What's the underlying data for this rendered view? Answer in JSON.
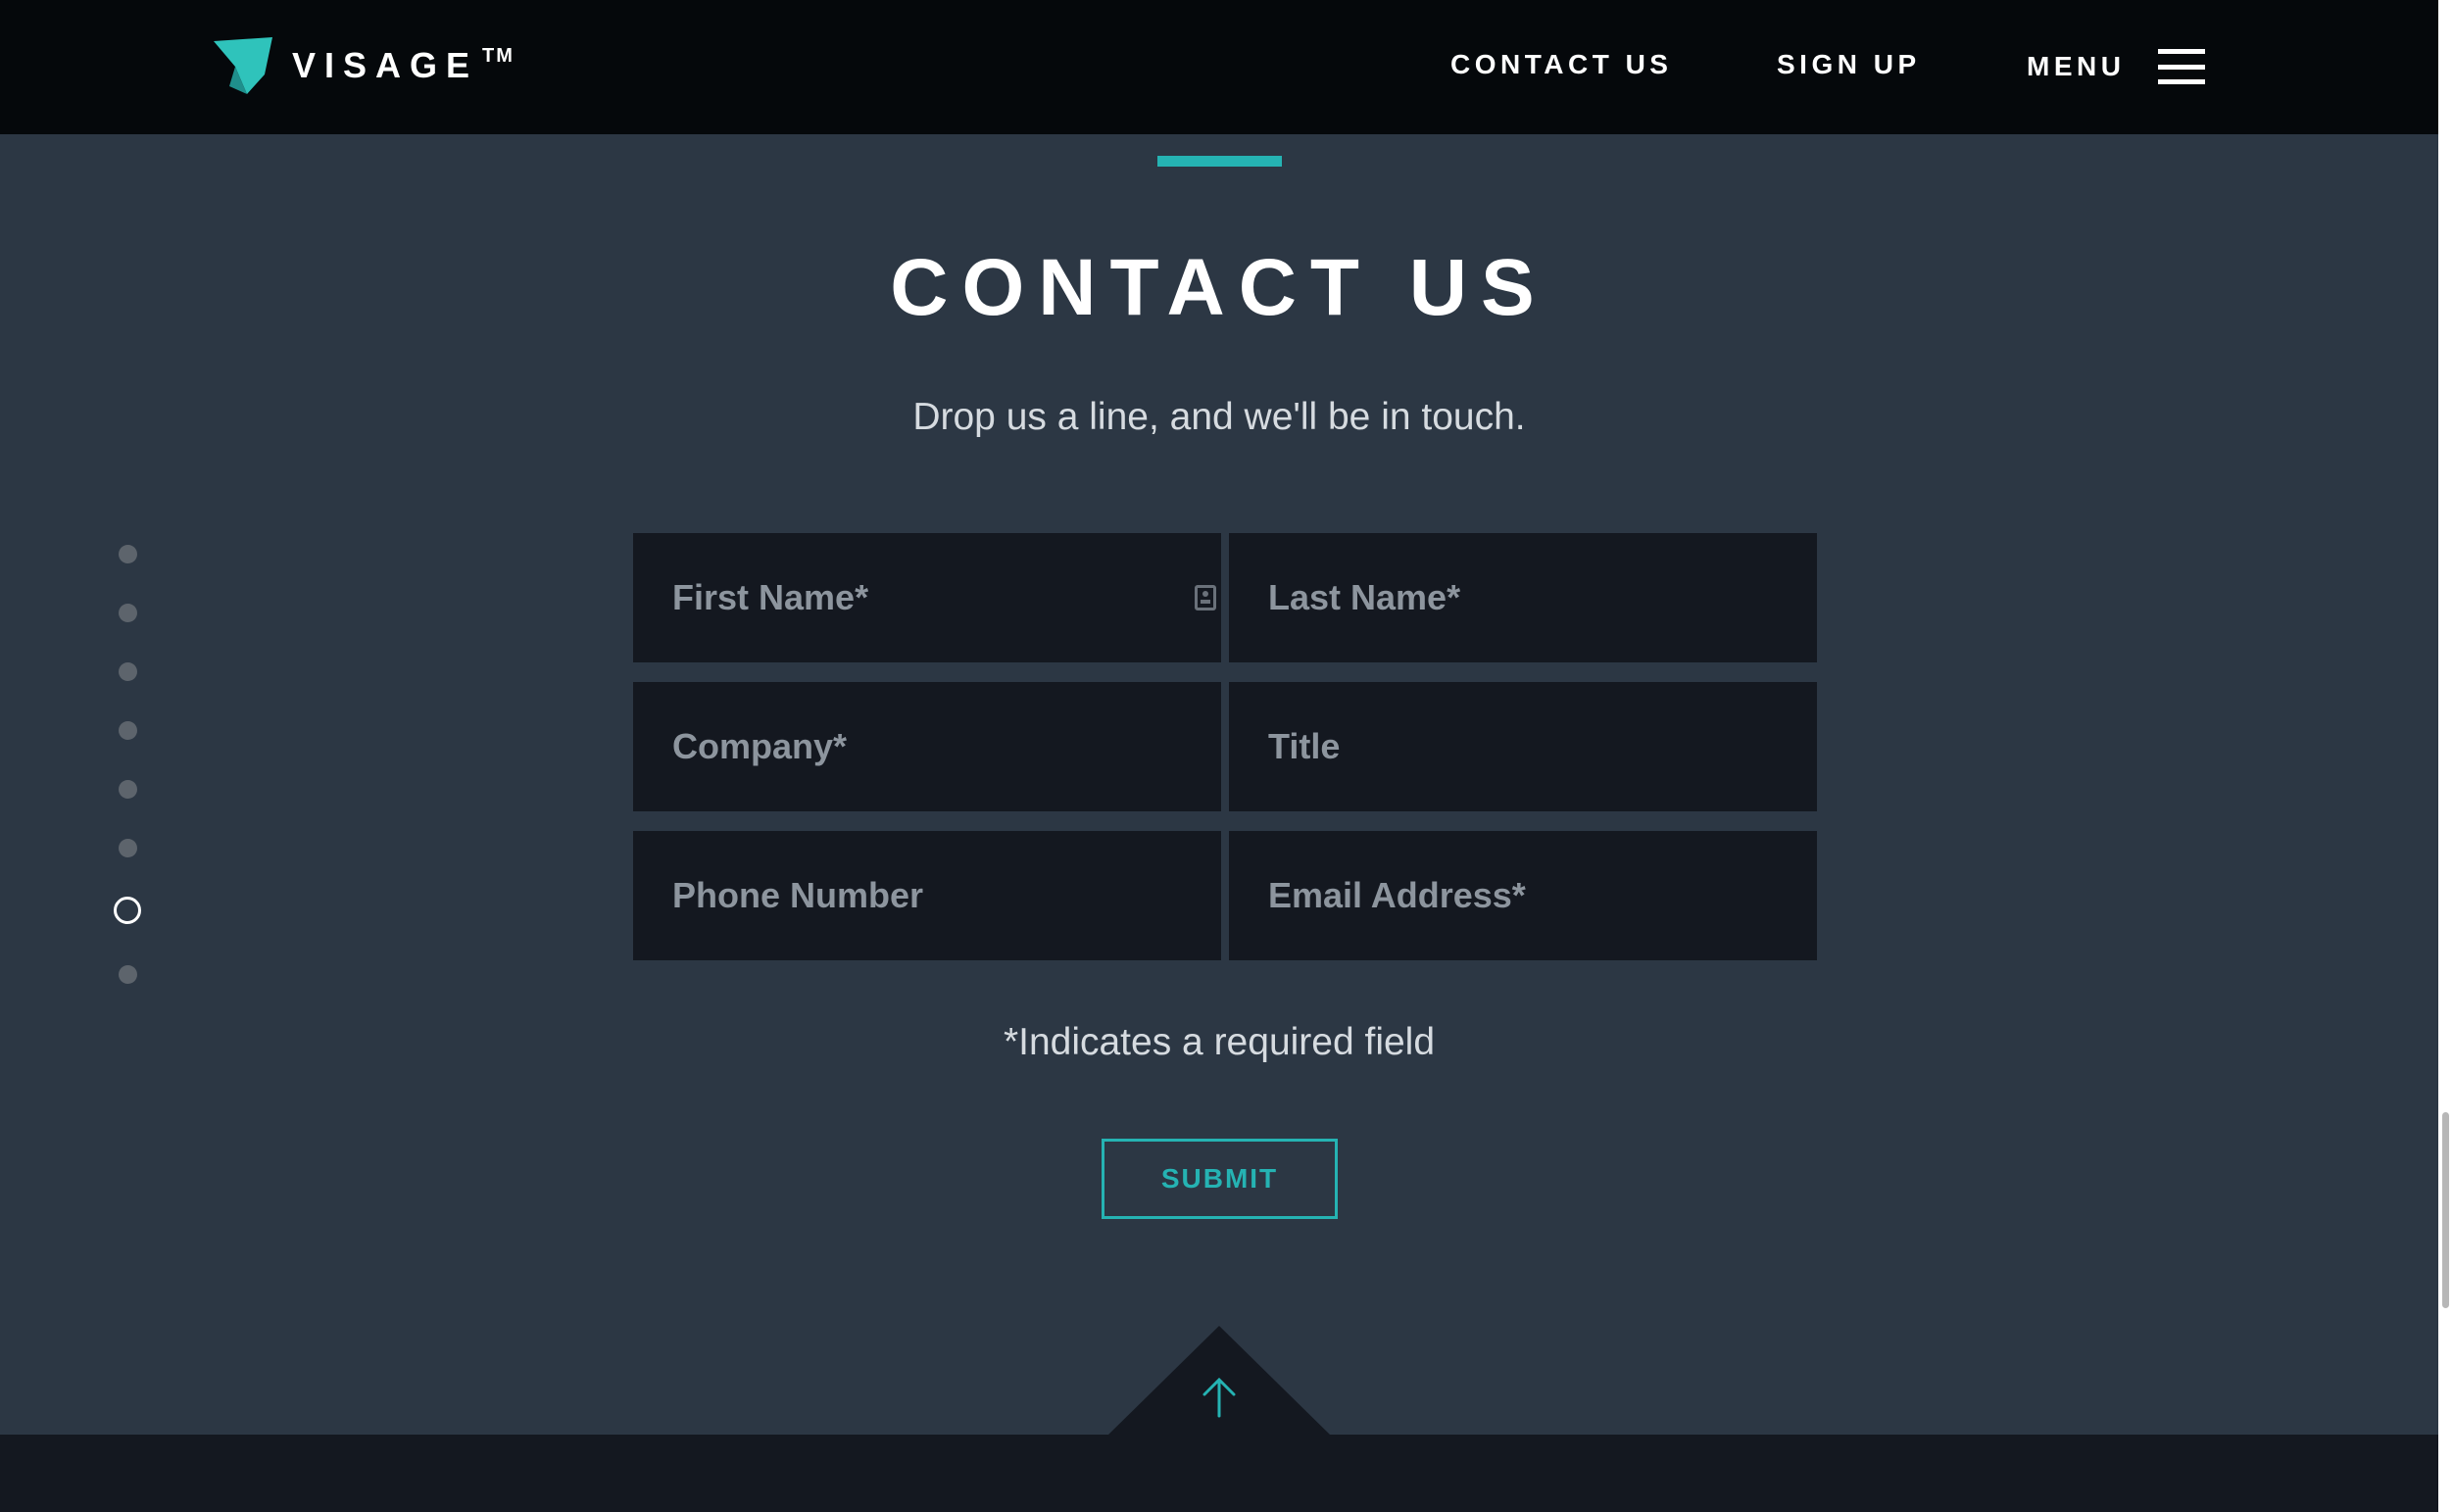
{
  "brand": {
    "name": "VISAGE",
    "trademark": "TM",
    "accent_color": "#25b3b3"
  },
  "nav": {
    "contact_label": "CONTACT US",
    "signup_label": "SIGN UP",
    "menu_label": "MENU"
  },
  "section": {
    "title": "CONTACT US",
    "subtitle": "Drop us a line, and we'll be in touch."
  },
  "side_nav": {
    "dot_count": 8,
    "active_index": 6
  },
  "form": {
    "fields": {
      "first_name": {
        "placeholder": "First Name*",
        "value": ""
      },
      "last_name": {
        "placeholder": "Last Name*",
        "value": ""
      },
      "company": {
        "placeholder": "Company*",
        "value": ""
      },
      "title": {
        "placeholder": "Title",
        "value": ""
      },
      "phone": {
        "placeholder": "Phone Number",
        "value": ""
      },
      "email": {
        "placeholder": "Email Address*",
        "value": ""
      }
    },
    "required_note": "*Indicates a required field",
    "submit_label": "SUBMIT"
  },
  "icons": {
    "logo": "visage-logo-icon",
    "menu": "hamburger-menu-icon",
    "autofill": "contact-card-icon",
    "back_to_top": "arrow-up-icon"
  }
}
